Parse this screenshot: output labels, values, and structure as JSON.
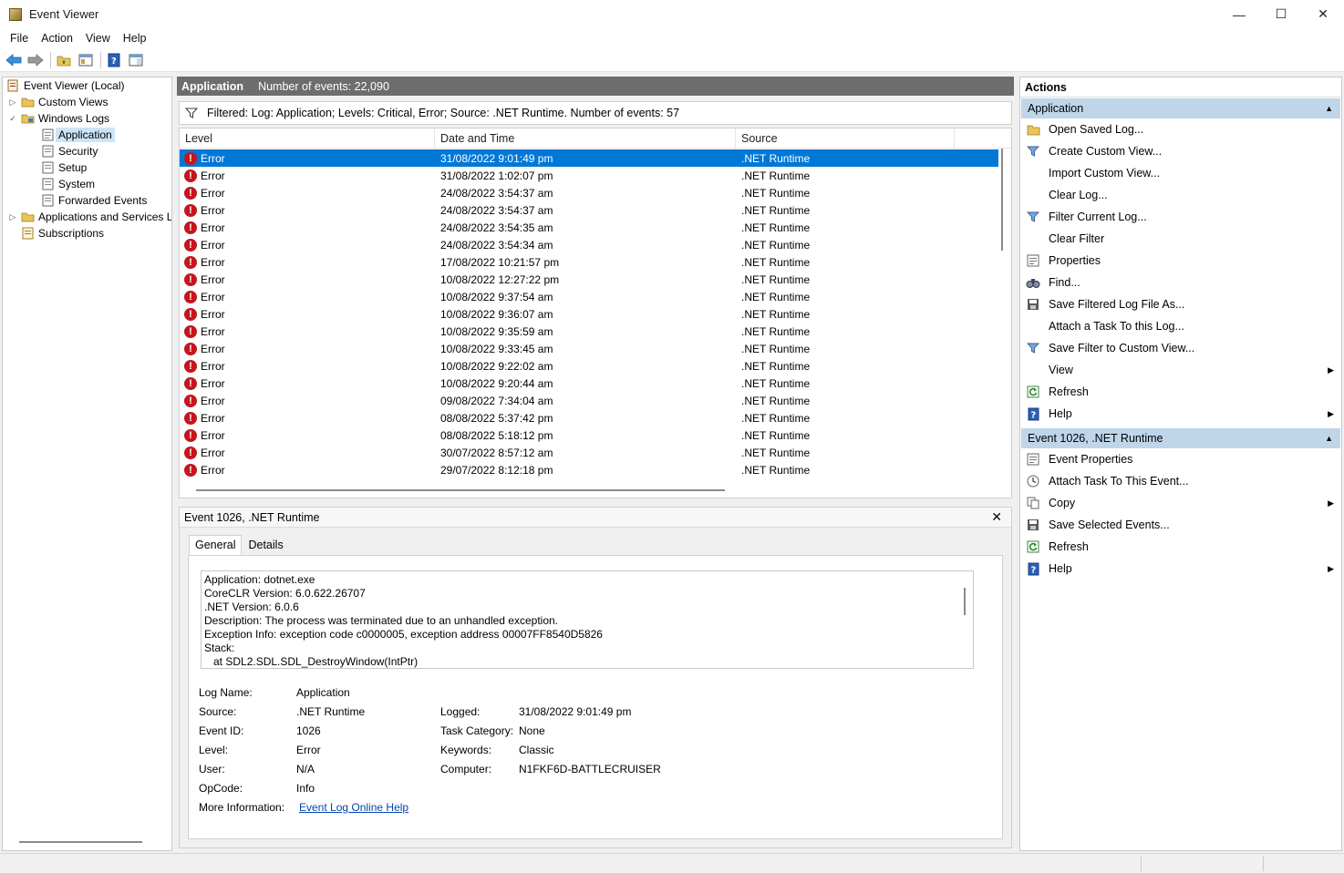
{
  "window": {
    "title": "Event Viewer"
  },
  "menu": [
    "File",
    "Action",
    "View",
    "Help"
  ],
  "tree": {
    "root": "Event Viewer (Local)",
    "custom_views": "Custom Views",
    "windows_logs": "Windows Logs",
    "logs": [
      "Application",
      "Security",
      "Setup",
      "System",
      "Forwarded Events"
    ],
    "apps_services": "Applications and Services L",
    "subscriptions": "Subscriptions"
  },
  "header": {
    "log_name": "Application",
    "event_count": "Number of events: 22,090"
  },
  "filter": {
    "text": "Filtered: Log: Application; Levels: Critical, Error; Source: .NET Runtime. Number of events: 57"
  },
  "columns": {
    "level": "Level",
    "date": "Date and Time",
    "source": "Source"
  },
  "events": [
    {
      "level": "Error",
      "date": "31/08/2022 9:01:49 pm",
      "source": ".NET Runtime"
    },
    {
      "level": "Error",
      "date": "31/08/2022 1:02:07 pm",
      "source": ".NET Runtime"
    },
    {
      "level": "Error",
      "date": "24/08/2022 3:54:37 am",
      "source": ".NET Runtime"
    },
    {
      "level": "Error",
      "date": "24/08/2022 3:54:37 am",
      "source": ".NET Runtime"
    },
    {
      "level": "Error",
      "date": "24/08/2022 3:54:35 am",
      "source": ".NET Runtime"
    },
    {
      "level": "Error",
      "date": "24/08/2022 3:54:34 am",
      "source": ".NET Runtime"
    },
    {
      "level": "Error",
      "date": "17/08/2022 10:21:57 pm",
      "source": ".NET Runtime"
    },
    {
      "level": "Error",
      "date": "10/08/2022 12:27:22 pm",
      "source": ".NET Runtime"
    },
    {
      "level": "Error",
      "date": "10/08/2022 9:37:54 am",
      "source": ".NET Runtime"
    },
    {
      "level": "Error",
      "date": "10/08/2022 9:36:07 am",
      "source": ".NET Runtime"
    },
    {
      "level": "Error",
      "date": "10/08/2022 9:35:59 am",
      "source": ".NET Runtime"
    },
    {
      "level": "Error",
      "date": "10/08/2022 9:33:45 am",
      "source": ".NET Runtime"
    },
    {
      "level": "Error",
      "date": "10/08/2022 9:22:02 am",
      "source": ".NET Runtime"
    },
    {
      "level": "Error",
      "date": "10/08/2022 9:20:44 am",
      "source": ".NET Runtime"
    },
    {
      "level": "Error",
      "date": "09/08/2022 7:34:04 am",
      "source": ".NET Runtime"
    },
    {
      "level": "Error",
      "date": "08/08/2022 5:37:42 pm",
      "source": ".NET Runtime"
    },
    {
      "level": "Error",
      "date": "08/08/2022 5:18:12 pm",
      "source": ".NET Runtime"
    },
    {
      "level": "Error",
      "date": "30/07/2022 8:57:12 am",
      "source": ".NET Runtime"
    },
    {
      "level": "Error",
      "date": "29/07/2022 8:12:18 pm",
      "source": ".NET Runtime"
    }
  ],
  "detail": {
    "title": "Event 1026, .NET Runtime",
    "tabs": [
      "General",
      "Details"
    ],
    "description": [
      "Application: dotnet.exe",
      "CoreCLR Version: 6.0.622.26707",
      ".NET Version: 6.0.6",
      "Description: The process was terminated due to an unhandled exception.",
      "Exception Info: exception code c0000005, exception address 00007FF8540D5826",
      "Stack:",
      "   at SDL2.SDL.SDL_DestroyWindow(IntPtr)"
    ],
    "labels": {
      "log_name": "Log Name:",
      "source": "Source:",
      "event_id": "Event ID:",
      "level": "Level:",
      "user": "User:",
      "opcode": "OpCode:",
      "more_info": "More Information:",
      "logged": "Logged:",
      "task_category": "Task Category:",
      "keywords": "Keywords:",
      "computer": "Computer:"
    },
    "values": {
      "log_name": "Application",
      "source": ".NET Runtime",
      "event_id": "1026",
      "level": "Error",
      "user": "N/A",
      "opcode": "Info",
      "more_info_link": "Event Log Online Help",
      "logged": "31/08/2022 9:01:49 pm",
      "task_category": "None",
      "keywords": "Classic",
      "computer": "N1FKF6D-BATTLECRUISER"
    }
  },
  "actions": {
    "title": "Actions",
    "section1": "Application",
    "section1_items": [
      {
        "label": "Open Saved Log...",
        "icon": "folder-icon",
        "submenu": false
      },
      {
        "label": "Create Custom View...",
        "icon": "funnel-icon",
        "submenu": false
      },
      {
        "label": "Import Custom View...",
        "icon": "",
        "submenu": false
      },
      {
        "label": "Clear Log...",
        "icon": "",
        "submenu": false
      },
      {
        "label": "Filter Current Log...",
        "icon": "funnel-icon",
        "submenu": false
      },
      {
        "label": "Clear Filter",
        "icon": "",
        "submenu": false
      },
      {
        "label": "Properties",
        "icon": "properties-icon",
        "submenu": false
      },
      {
        "label": "Find...",
        "icon": "binoculars-icon",
        "submenu": false
      },
      {
        "label": "Save Filtered Log File As...",
        "icon": "save-icon",
        "submenu": false
      },
      {
        "label": "Attach a Task To this Log...",
        "icon": "",
        "submenu": false
      },
      {
        "label": "Save Filter to Custom View...",
        "icon": "funnel-icon",
        "submenu": false
      },
      {
        "label": "View",
        "icon": "",
        "submenu": true
      },
      {
        "label": "Refresh",
        "icon": "refresh-icon",
        "submenu": false
      },
      {
        "label": "Help",
        "icon": "help-icon",
        "submenu": true
      }
    ],
    "section2": "Event 1026, .NET Runtime",
    "section2_items": [
      {
        "label": "Event Properties",
        "icon": "properties-icon",
        "submenu": false
      },
      {
        "label": "Attach Task To This Event...",
        "icon": "task-icon",
        "submenu": false
      },
      {
        "label": "Copy",
        "icon": "copy-icon",
        "submenu": true
      },
      {
        "label": "Save Selected Events...",
        "icon": "save-icon",
        "submenu": false
      },
      {
        "label": "Refresh",
        "icon": "refresh-icon",
        "submenu": false
      },
      {
        "label": "Help",
        "icon": "help-icon",
        "submenu": true
      }
    ]
  }
}
